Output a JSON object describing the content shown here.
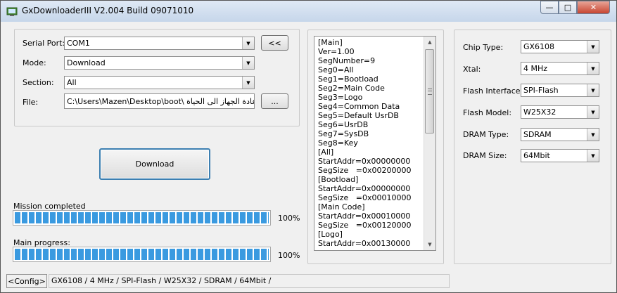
{
  "window": {
    "title": "GxDownloaderIII V2.004 Build 09071010",
    "minimize_glyph": "—",
    "maximize_glyph": "□",
    "close_glyph": "✕",
    "app_icon": "gx-downloader-app-icon"
  },
  "settings": {
    "serial_port_label": "Serial Port:",
    "serial_port_value": "COM1",
    "toggle_button": "<<",
    "mode_label": "Mode:",
    "mode_value": "Download",
    "section_label": "Section:",
    "section_value": "All",
    "file_label": "File:",
    "file_value": "C:\\Users\\Mazen\\Desktop\\boot\\ تا لاعادة الجهاز الى الحياة",
    "browse_button": "...",
    "dropdown_icon": "chevron-down-icon"
  },
  "actions": {
    "download_button": "Download"
  },
  "progress": {
    "mission_label": "Mission completed",
    "mission_value": 100,
    "mission_pct_text": "100%",
    "main_label": "Main progress:",
    "main_value": 100,
    "main_pct_text": "100%",
    "fill_color": "#3a9ae0"
  },
  "config_lines": [
    "[Main]",
    "Ver=1.00",
    "SegNumber=9",
    "Seg0=All",
    "Seg1=Bootload",
    "Seg2=Main Code",
    "Seg3=Logo",
    "Seg4=Common Data",
    "Seg5=Default UsrDB",
    "Seg6=UsrDB",
    "Seg7=SysDB",
    "Seg8=Key",
    "[All]",
    "StartAddr=0x00000000",
    "SegSize   =0x00200000",
    "[Bootload]",
    "StartAddr=0x00000000",
    "SegSize   =0x00010000",
    "[Main Code]",
    "StartAddr=0x00010000",
    "SegSize   =0x00120000",
    "[Logo]",
    "StartAddr=0x00130000"
  ],
  "chip": {
    "chip_type_label": "Chip Type:",
    "chip_type_value": "GX6108",
    "xtal_label": "Xtal:",
    "xtal_value": "4 MHz",
    "flash_interface_label": "Flash Interface:",
    "flash_interface_value": "SPI-Flash",
    "flash_model_label": "Flash Model:",
    "flash_model_value": "W25X32",
    "dram_type_label": "DRAM Type:",
    "dram_type_value": "SDRAM",
    "dram_size_label": "DRAM Size:",
    "dram_size_value": "64Mbit"
  },
  "status": {
    "tab_label": "<Config>",
    "text": "GX6108 / 4 MHz / SPI-Flash / W25X32 / SDRAM / 64Mbit /"
  }
}
